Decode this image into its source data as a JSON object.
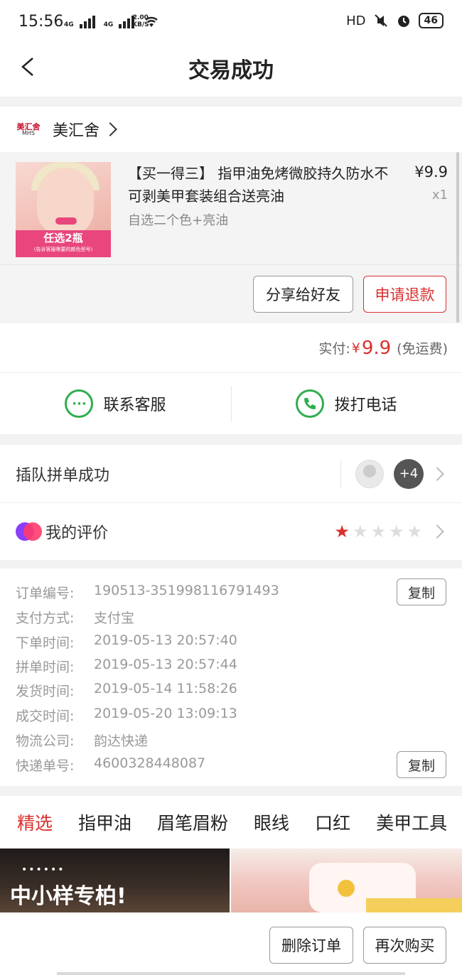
{
  "status_bar": {
    "time": "15:56",
    "net1": "4G",
    "net2": "4G",
    "speed_value": "2.00",
    "speed_unit": "KB/S",
    "hd": "HD",
    "battery": "46"
  },
  "nav": {
    "title": "交易成功"
  },
  "store": {
    "logo_text": "美汇舍",
    "logo_sub": "MHS",
    "name": "美汇舍"
  },
  "product": {
    "title": "【买一得三】 指甲油免烤微胶持久防水不可剥美甲套装组合送亮油",
    "spec": "自选二个色+亮油",
    "price": "¥9.9",
    "quantity": "x1",
    "image_banner": "任选2瓶",
    "image_banner_sub": "(告诉客服需要的颜色型号)"
  },
  "actions": {
    "share": "分享给好友",
    "refund": "申请退款"
  },
  "payment": {
    "label": "实付:",
    "currency": "¥",
    "amount": "9.9",
    "shipping_note": "(免运费)"
  },
  "contact": {
    "service": "联系客服",
    "call": "拨打电话"
  },
  "group": {
    "label": "插队拼单成功",
    "more_count": "+4"
  },
  "review": {
    "label": "我的评价",
    "rating": 1,
    "max": 5
  },
  "order_info": {
    "rows": [
      {
        "label": "订单编号:",
        "value": "190513-351998116791493"
      },
      {
        "label": "支付方式:",
        "value": "支付宝"
      },
      {
        "label": "下单时间:",
        "value": "2019-05-13 20:57:40"
      },
      {
        "label": "拼单时间:",
        "value": "2019-05-13 20:57:44"
      },
      {
        "label": "发货时间:",
        "value": "2019-05-14 11:58:26"
      },
      {
        "label": "成交时间:",
        "value": "2019-05-20 13:09:13"
      },
      {
        "label": "物流公司:",
        "value": "韵达快递"
      },
      {
        "label": "快递单号:",
        "value": "4600328448087"
      }
    ],
    "copy_label": "复制"
  },
  "categories": [
    "精选",
    "指甲油",
    "眉笔眉粉",
    "眼线",
    "口红",
    "美甲工具"
  ],
  "feed": {
    "left_caption": "中小样专柏!",
    "left_dots": "••••••"
  },
  "bottom_actions": {
    "delete": "删除订单",
    "rebuy": "再次购买"
  },
  "colors": {
    "accent": "#d9302e",
    "contact_green": "#2fae4e"
  }
}
